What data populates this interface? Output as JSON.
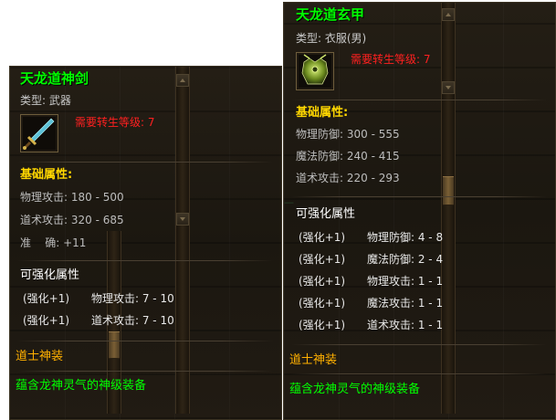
{
  "tooltips": [
    {
      "name": "天龙道神剑",
      "type_line": "类型: 武器",
      "requirement": "需要转生等级: 7",
      "base_title": "基础属性:",
      "base_stats": [
        "物理攻击: 180 - 500",
        "道术攻击: 320 - 685",
        "准    确: +11"
      ],
      "enhance_title": "可强化属性",
      "enhance_stats": [
        {
          "tag": "(强化+1)",
          "stat": "物理攻击: 7 - 10"
        },
        {
          "tag": "(强化+1)",
          "stat": "道术攻击: 7 - 10"
        }
      ],
      "set_name": "道士神装",
      "set_desc": "蕴含龙神灵气的神级装备",
      "icon": "sword-icon"
    },
    {
      "name": "天龙道玄甲",
      "type_line": "类型: 衣服(男)",
      "requirement": "需要转生等级: 7",
      "base_title": "基础属性:",
      "base_stats": [
        "物理防御: 300 - 555",
        "魔法防御: 240 - 415",
        "道术攻击: 220 - 293"
      ],
      "enhance_title": "可强化属性",
      "enhance_stats": [
        {
          "tag": "(强化+1)",
          "stat": "物理防御: 4 - 8"
        },
        {
          "tag": "(强化+1)",
          "stat": "魔法防御: 2 - 4"
        },
        {
          "tag": "(强化+1)",
          "stat": "物理攻击: 1 - 1"
        },
        {
          "tag": "(强化+1)",
          "stat": "魔法攻击: 1 - 1"
        },
        {
          "tag": "(强化+1)",
          "stat": "道术攻击: 1 - 1"
        }
      ],
      "set_name": "道士神装",
      "set_desc": "蕴含龙神灵气的神级装备",
      "icon": "armor-icon"
    }
  ],
  "colors": {
    "item_name": "#00ff00",
    "requirement": "#ff2020",
    "section_title": "#ffd700",
    "set_name": "#ffb000",
    "set_desc": "#00ff00"
  }
}
